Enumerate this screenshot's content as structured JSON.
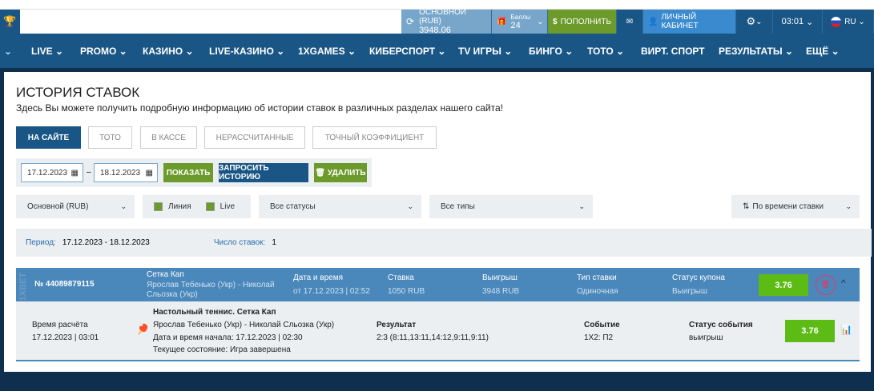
{
  "topbar": {
    "balance_label": "ОСНОВНОЙ (RUB)",
    "balance_value": "3948.06",
    "points_label": "Баллы",
    "points_value": "24",
    "deposit": "ПОПОЛНИТЬ",
    "cabinet": "ЛИЧНЫЙ КАБИНЕТ",
    "time": "03:01",
    "lang": "RU"
  },
  "nav": [
    "LIVE",
    "PROMO",
    "КАЗИНО",
    "LIVE-КАЗИНО",
    "1XGAMES",
    "КИБЕРСПОРТ",
    "TV ИГРЫ",
    "БИНГО",
    "ТОТО",
    "ВИРТ. СПОРТ",
    "РЕЗУЛЬТАТЫ",
    "ЕЩЁ"
  ],
  "page": {
    "title": "ИСТОРИЯ СТАВОК",
    "subtitle": "Здесь Вы можете получить подробную информацию об истории ставок в различных разделах нашего сайта!",
    "tabs": [
      "НА САЙТЕ",
      "ТОТО",
      "В КАССЕ",
      "НЕРАССЧИТАННЫЕ",
      "ТОЧНЫЙ КОЭФФИЦИЕНТ"
    ],
    "date_from": "17.12.2023",
    "date_to": "18.12.2023",
    "show": "ПОКАЗАТЬ",
    "request": "ЗАПРОСИТЬ ИСТОРИЮ",
    "delete": "УДАЛИТЬ",
    "account": "Основной (RUB)",
    "line": "Линия",
    "live": "Live",
    "statuses": "Все статусы",
    "types": "Все типы",
    "sort": "По времени ставки",
    "period_label": "Период:",
    "period_value": "17.12.2023 - 18.12.2023",
    "count_label": "Число ставок:",
    "count_value": "1"
  },
  "bet": {
    "number": "№ 44089879115",
    "tournament": "Сетка Кап",
    "match": "Ярослав Тебенько (Укр) - Николай Сльозка (Укр)",
    "date_label": "Дата и время",
    "date_value": "от 17.12.2023 | 02:52",
    "stake_label": "Ставка",
    "stake_value": "1050 RUB",
    "win_label": "Выигрыш",
    "win_value": "3948 RUB",
    "type_label": "Тип ставки",
    "type_value": "Одиночная",
    "status_label": "Статус купона",
    "status_value": "Выигрыш",
    "odds": "3.76",
    "detail": {
      "calc_label": "Время расчёта",
      "calc_value": "17.12.2023 | 03:01",
      "event_title": "Настольный теннис. Сетка Кап",
      "match": "Ярослав Тебенько (Укр) - Николай Сльозка (Укр)",
      "start": "Дата и время начала: 17.12.2023 | 02:30",
      "state": "Текущее состояние: Игра завершена",
      "result_label": "Результат",
      "result_value": "2:3 (8:11,13:11,14:12,9:11,9:11)",
      "event_label": "Событие",
      "event_value": "1Х2: П2",
      "estatus_label": "Статус события",
      "estatus_value": "выигрыш",
      "odds": "3.76"
    }
  }
}
